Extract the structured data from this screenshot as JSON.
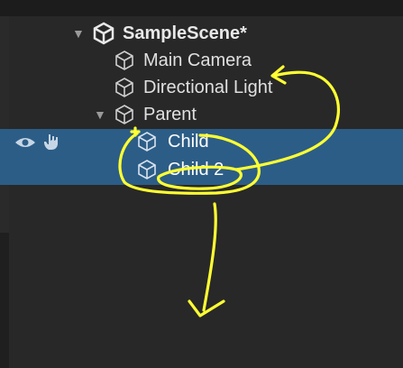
{
  "hierarchy": {
    "scene": {
      "label": "SampleScene*",
      "icon": "unity-logo-icon"
    },
    "items": [
      {
        "label": "Main Camera",
        "icon": "gameobject-cube-icon"
      },
      {
        "label": "Directional Light",
        "icon": "gameobject-cube-icon"
      },
      {
        "label": "Parent",
        "icon": "gameobject-cube-icon"
      },
      {
        "label": "Child",
        "icon": "gameobject-cube-icon",
        "selected": true
      },
      {
        "label": "Child 2",
        "icon": "gameobject-cube-icon",
        "selected": true
      }
    ]
  },
  "annotation": {
    "color": "#ffff33"
  },
  "colors": {
    "selection": "#2c5d87",
    "panel": "#282828",
    "text": "#e0e0e0"
  }
}
